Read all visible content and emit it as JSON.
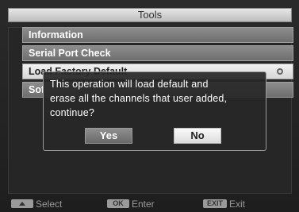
{
  "header": {
    "title": "Tools"
  },
  "menu": {
    "items": [
      {
        "label": "Information"
      },
      {
        "label": "Serial Port Check"
      },
      {
        "label": "Load Factory Default"
      },
      {
        "label": "Sof"
      }
    ]
  },
  "dialog": {
    "message_line1": "This operation will load default and",
    "message_line2": "erase all the channels that user added,",
    "message_line3": "continue?",
    "yes_label": "Yes",
    "no_label": "No"
  },
  "footer": {
    "select_label": "Select",
    "ok_key": "OK",
    "enter_label": "Enter",
    "exit_key": "EXIT",
    "exit_label": "Exit"
  }
}
